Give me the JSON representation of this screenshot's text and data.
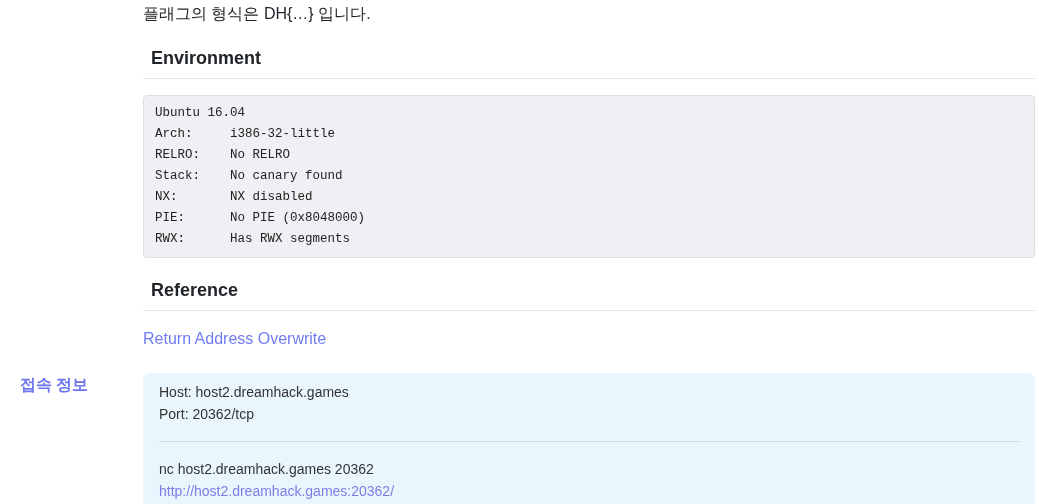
{
  "description": {
    "intro": "플래그의 형식은 DH{…} 입니다.",
    "sections": [
      {
        "heading": "Environment",
        "kind": "code",
        "lines": [
          "Ubuntu 16.04",
          "Arch:     i386-32-little",
          "RELRO:    No RELRO",
          "Stack:    No canary found",
          "NX:       NX disabled",
          "PIE:      No PIE (0x8048000)",
          "RWX:      Has RWX segments"
        ]
      },
      {
        "heading": "Reference",
        "kind": "links",
        "links": [
          "Return Address Overwrite"
        ]
      }
    ]
  },
  "connection": {
    "label": "접속 정보",
    "host": "Host: host2.dreamhack.games",
    "port": "Port: 20362/tcp",
    "command": "nc host2.dreamhack.games 20362",
    "url": "http://host2.dreamhack.games:20362/"
  }
}
